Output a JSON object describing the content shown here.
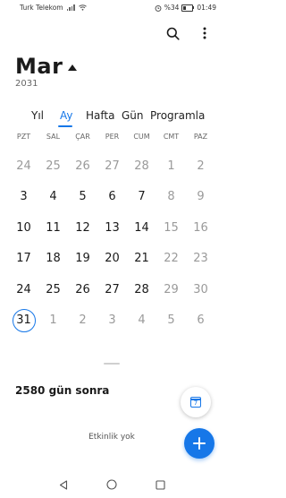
{
  "status_bar": {
    "carrier": "Turk Telekom",
    "battery_text": "%34",
    "time": "01:49"
  },
  "header": {
    "month": "Mar",
    "year": "2031",
    "actions": [
      {
        "icon": "search-icon"
      },
      {
        "icon": "more-vertical-icon"
      }
    ]
  },
  "view_tabs": [
    {
      "label": "Yıl",
      "active": false
    },
    {
      "label": "Ay",
      "active": true
    },
    {
      "label": "Hafta",
      "active": false
    },
    {
      "label": "Gün",
      "active": false
    },
    {
      "label": "Programla",
      "active": false
    }
  ],
  "weekdays": [
    "PZT",
    "SAL",
    "ÇAR",
    "PER",
    "CUM",
    "CMT",
    "PAZ"
  ],
  "weeks": [
    [
      {
        "d": "24",
        "other": true
      },
      {
        "d": "25",
        "other": true
      },
      {
        "d": "26",
        "other": true
      },
      {
        "d": "27",
        "other": true
      },
      {
        "d": "28",
        "other": true
      },
      {
        "d": "1",
        "other": false
      },
      {
        "d": "2",
        "other": false
      }
    ],
    [
      {
        "d": "3",
        "other": false
      },
      {
        "d": "4",
        "other": false
      },
      {
        "d": "5",
        "other": false
      },
      {
        "d": "6",
        "other": false
      },
      {
        "d": "7",
        "other": false
      },
      {
        "d": "8",
        "other": false
      },
      {
        "d": "9",
        "other": false
      }
    ],
    [
      {
        "d": "10",
        "other": false
      },
      {
        "d": "11",
        "other": false
      },
      {
        "d": "12",
        "other": false
      },
      {
        "d": "13",
        "other": false
      },
      {
        "d": "14",
        "other": false
      },
      {
        "d": "15",
        "other": false
      },
      {
        "d": "16",
        "other": false
      }
    ],
    [
      {
        "d": "17",
        "other": false
      },
      {
        "d": "18",
        "other": false
      },
      {
        "d": "19",
        "other": false
      },
      {
        "d": "20",
        "other": false
      },
      {
        "d": "21",
        "other": false
      },
      {
        "d": "22",
        "other": false
      },
      {
        "d": "23",
        "other": false
      }
    ],
    [
      {
        "d": "24",
        "other": false
      },
      {
        "d": "25",
        "other": false
      },
      {
        "d": "26",
        "other": false
      },
      {
        "d": "27",
        "other": false
      },
      {
        "d": "28",
        "other": false
      },
      {
        "d": "29",
        "other": false
      },
      {
        "d": "30",
        "other": false
      }
    ],
    [
      {
        "d": "31",
        "other": false,
        "selected": true
      },
      {
        "d": "1",
        "other": true
      },
      {
        "d": "2",
        "other": true
      },
      {
        "d": "3",
        "other": true
      },
      {
        "d": "4",
        "other": true
      },
      {
        "d": "5",
        "other": true
      },
      {
        "d": "6",
        "other": true
      }
    ]
  ],
  "selected_info": "2580 gün sonra",
  "today_button_day": "7",
  "empty_state": "Etkinlik yok",
  "accent_color": "#1677e8",
  "nav_bar": [
    {
      "icon": "back-icon"
    },
    {
      "icon": "home-icon"
    },
    {
      "icon": "recents-icon"
    }
  ]
}
